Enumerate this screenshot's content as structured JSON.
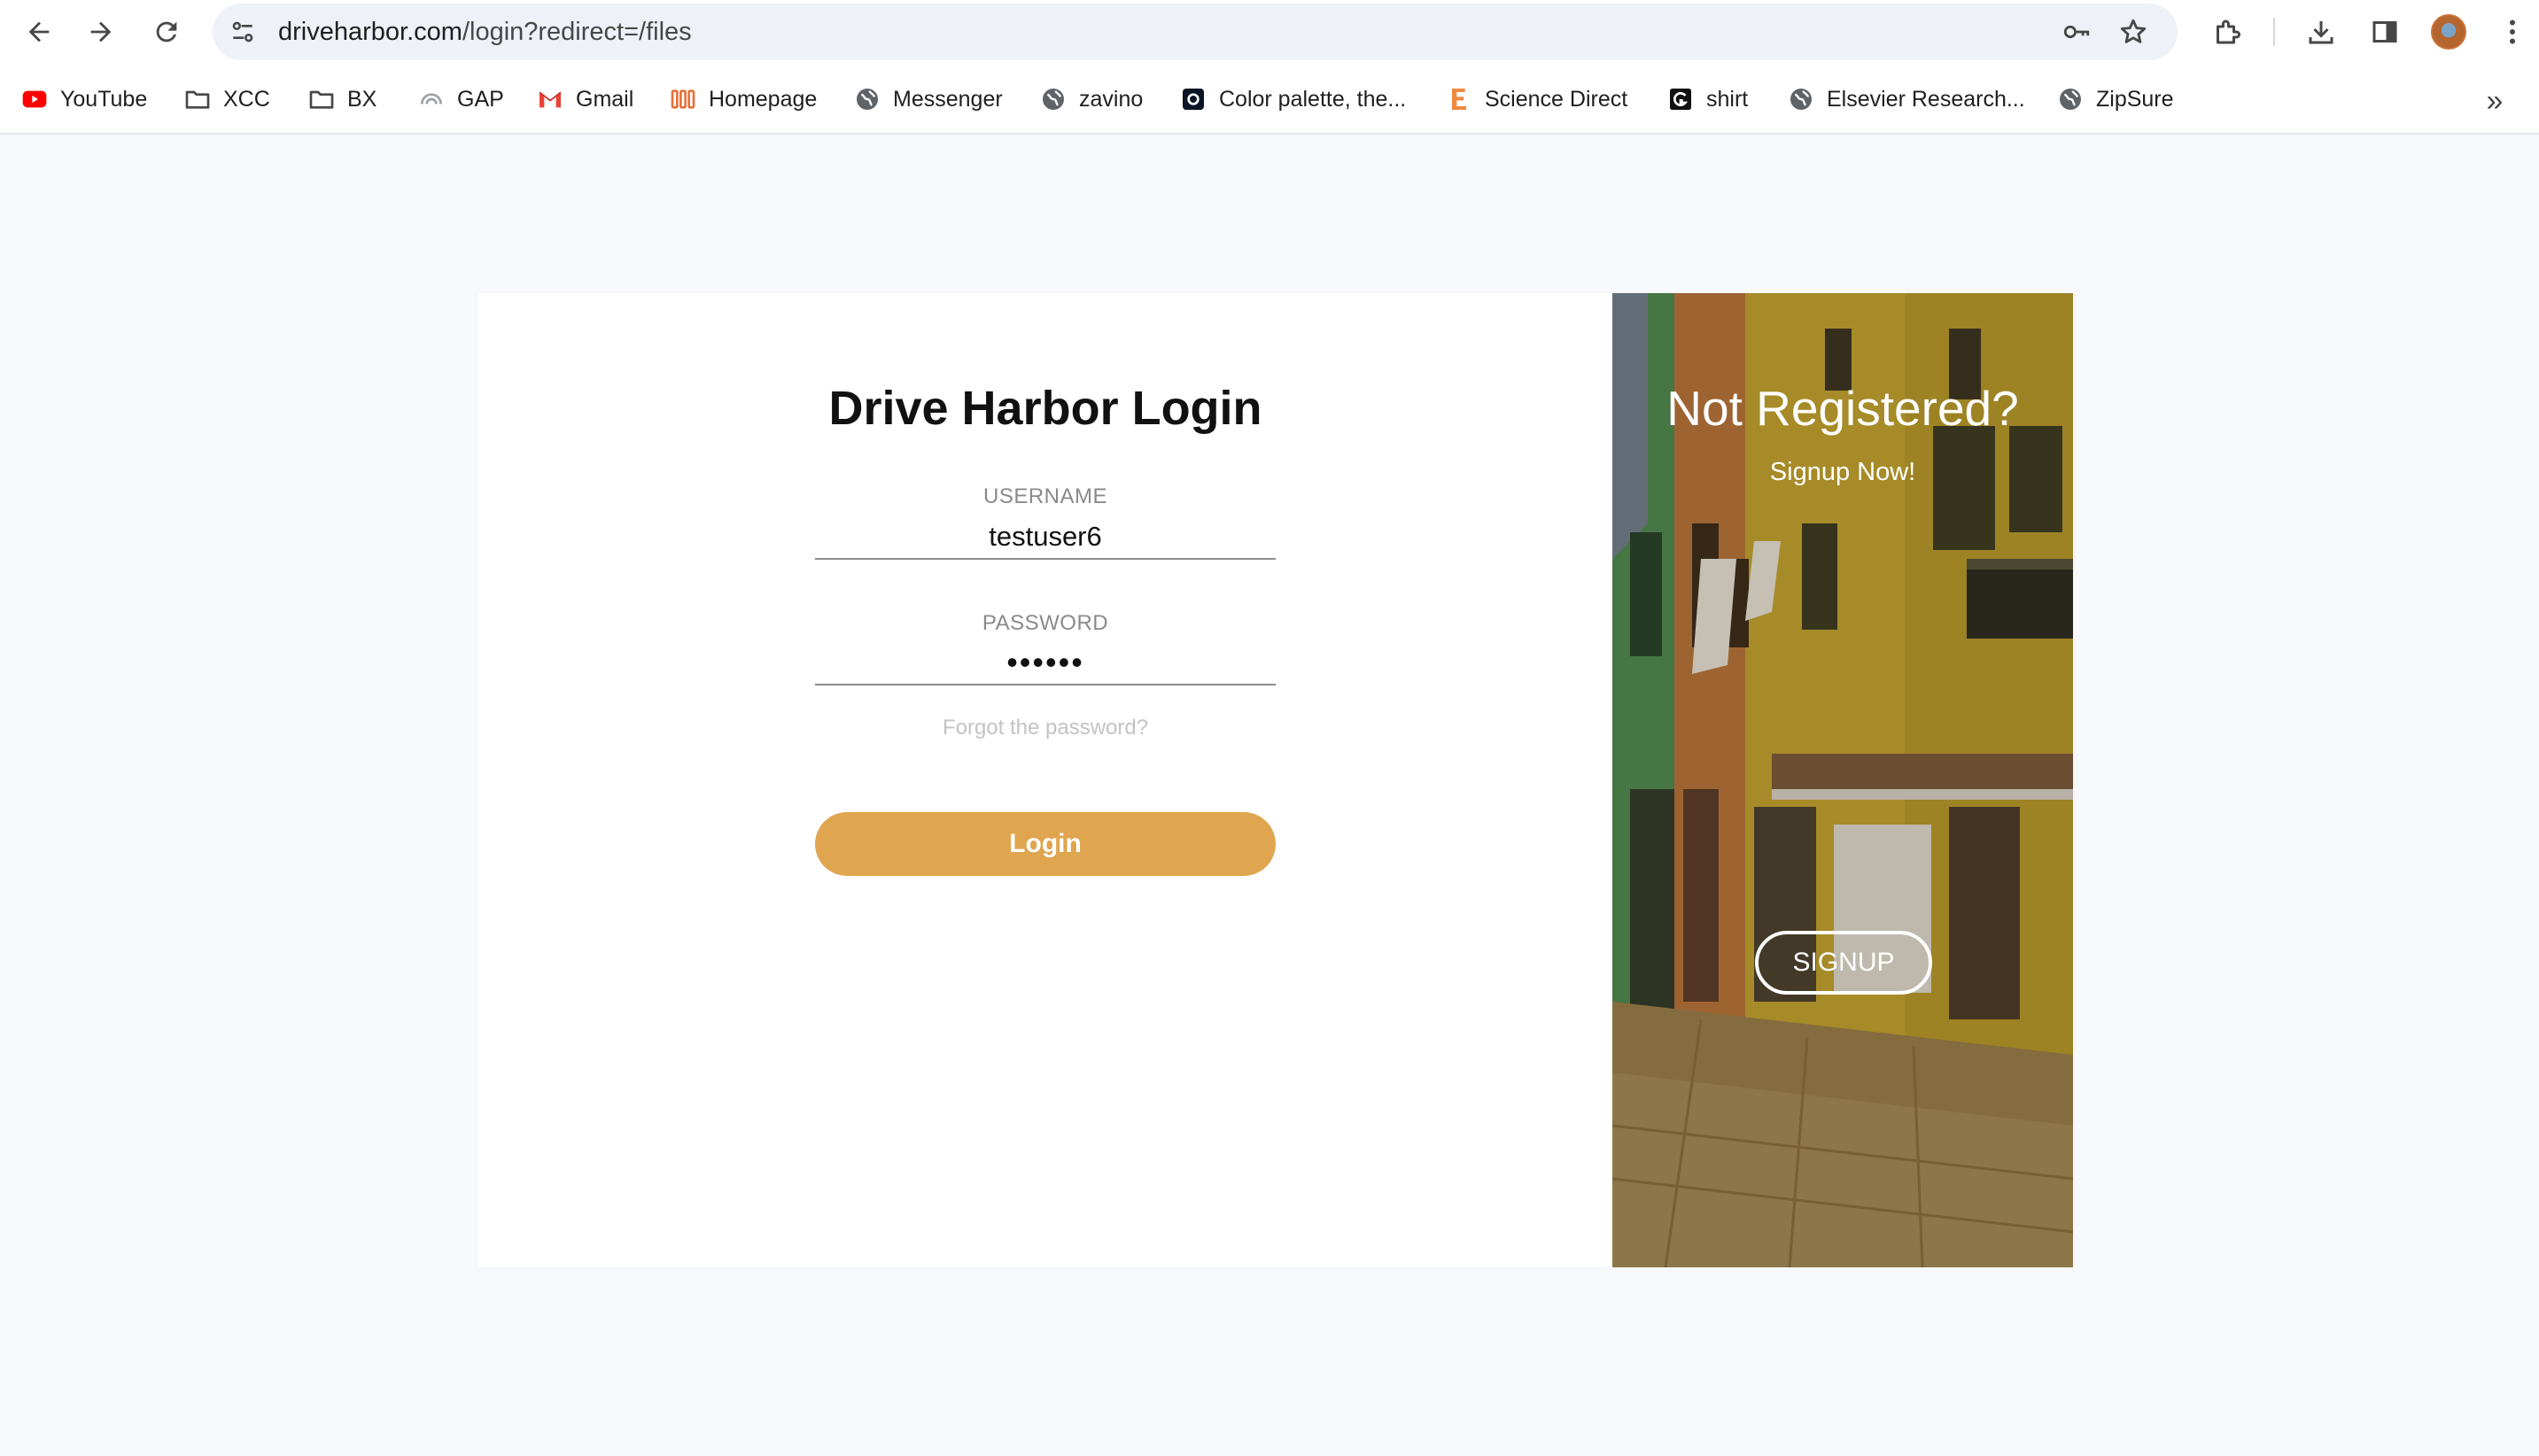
{
  "browser": {
    "url_host": "driveharbor.com",
    "url_path": "/login?redirect=/files",
    "bookmarks": [
      {
        "label": "YouTube",
        "icon": "youtube-icon"
      },
      {
        "label": "XCC",
        "icon": "folder-icon"
      },
      {
        "label": "BX",
        "icon": "folder-icon"
      },
      {
        "label": "GAP",
        "icon": "gap-icon"
      },
      {
        "label": "Gmail",
        "icon": "gmail-icon"
      },
      {
        "label": "Homepage",
        "icon": "homepage-icon"
      },
      {
        "label": "Messenger",
        "icon": "globe-icon"
      },
      {
        "label": "zavino",
        "icon": "globe-icon"
      },
      {
        "label": "Color palette, the...",
        "icon": "coolors-icon"
      },
      {
        "label": "Science Direct",
        "icon": "elsevier-icon"
      },
      {
        "label": "shirt",
        "icon": "g-icon"
      },
      {
        "label": "Elsevier Research...",
        "icon": "globe-icon"
      },
      {
        "label": "ZipSure",
        "icon": "globe-icon"
      }
    ],
    "more_bookmarks": "»"
  },
  "login": {
    "title": "Drive Harbor Login",
    "username_label": "USERNAME",
    "username_value": "testuser6",
    "password_label": "PASSWORD",
    "password_value": "••••••",
    "forgot_link": "Forgot the password?",
    "login_button": "Login"
  },
  "signup_panel": {
    "title": "Not Registered?",
    "subtitle": "Signup Now!",
    "signup_button": "SIGNUP"
  },
  "colors": {
    "accent": "#e0a54f",
    "page_background": "#f8f9fd"
  }
}
